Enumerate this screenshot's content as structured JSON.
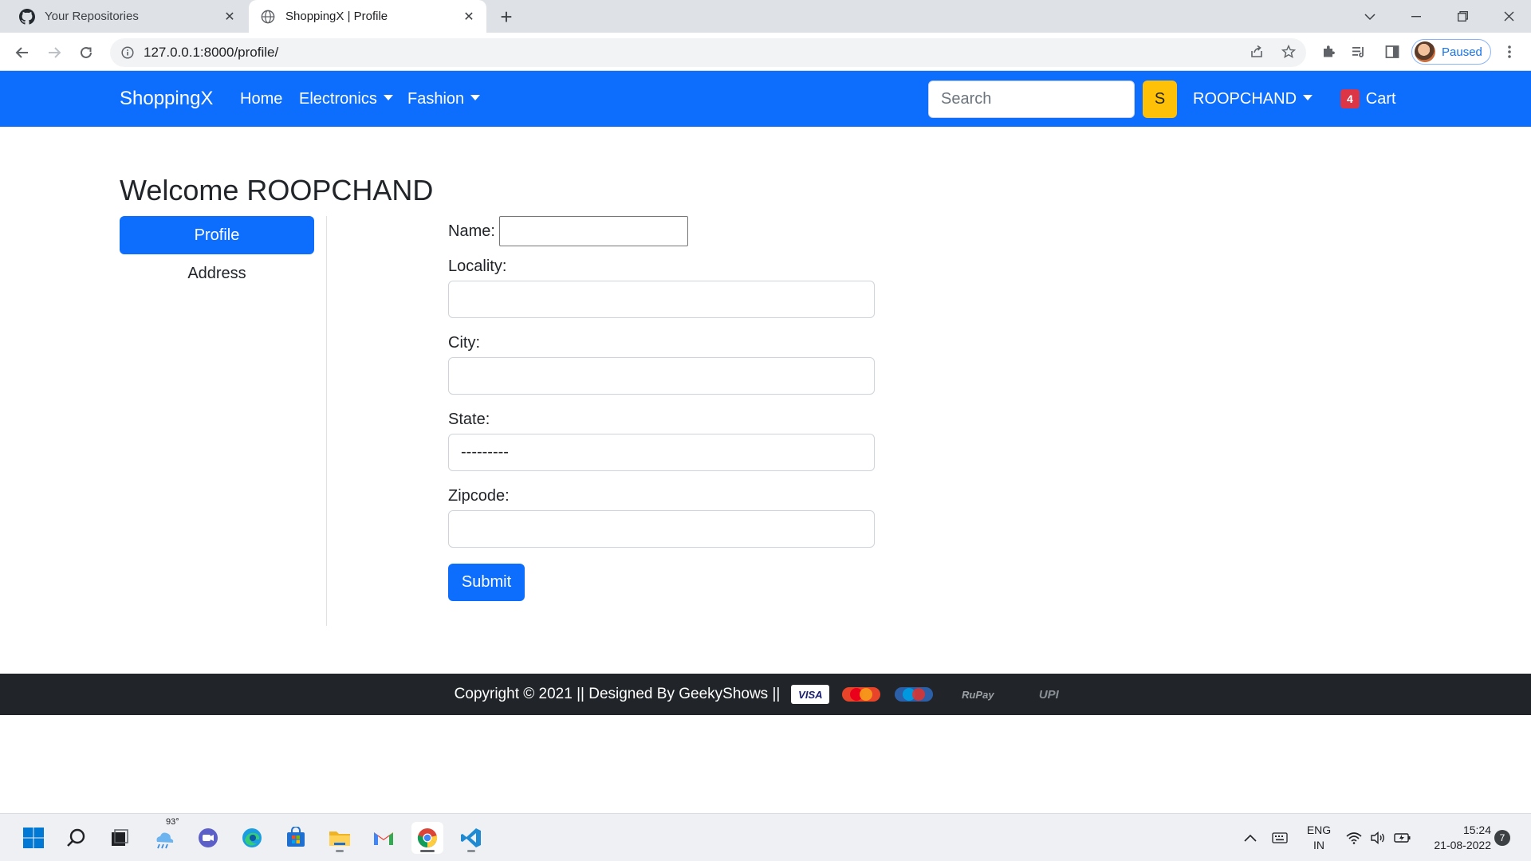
{
  "browser": {
    "tabs": [
      {
        "title": "Your Repositories",
        "favicon": "github-icon"
      },
      {
        "title": "ShoppingX | Profile",
        "favicon": "globe-icon"
      }
    ],
    "url": "127.0.0.1:8000/profile/",
    "profile_status": "Paused"
  },
  "navbar": {
    "brand": "ShoppingX",
    "links": {
      "home": "Home",
      "electronics": "Electronics",
      "fashion": "Fashion"
    },
    "search_placeholder": "Search",
    "search_button": "S",
    "user": "ROOPCHAND",
    "cart_count": "4",
    "cart_label": "Cart",
    "color": "#0d6efd"
  },
  "page": {
    "welcome": "Welcome ROOPCHAND",
    "sidebar": {
      "profile": "Profile",
      "address": "Address"
    },
    "form": {
      "name_label": "Name:",
      "name_value": "",
      "locality_label": "Locality:",
      "locality_value": "",
      "city_label": "City:",
      "city_value": "",
      "state_label": "State:",
      "state_value": "---------",
      "zipcode_label": "Zipcode:",
      "zipcode_value": "",
      "submit": "Submit"
    }
  },
  "footer": {
    "text": "Copyright © 2021 || Designed By GeekyShows ||",
    "payments": {
      "visa": "VISA",
      "rupay": "RuPay",
      "upi": "UPI"
    }
  },
  "taskbar": {
    "weather": "93°",
    "lang_top": "ENG",
    "lang_bottom": "IN",
    "time": "15:24",
    "date": "21-08-2022",
    "notifications": "7"
  }
}
